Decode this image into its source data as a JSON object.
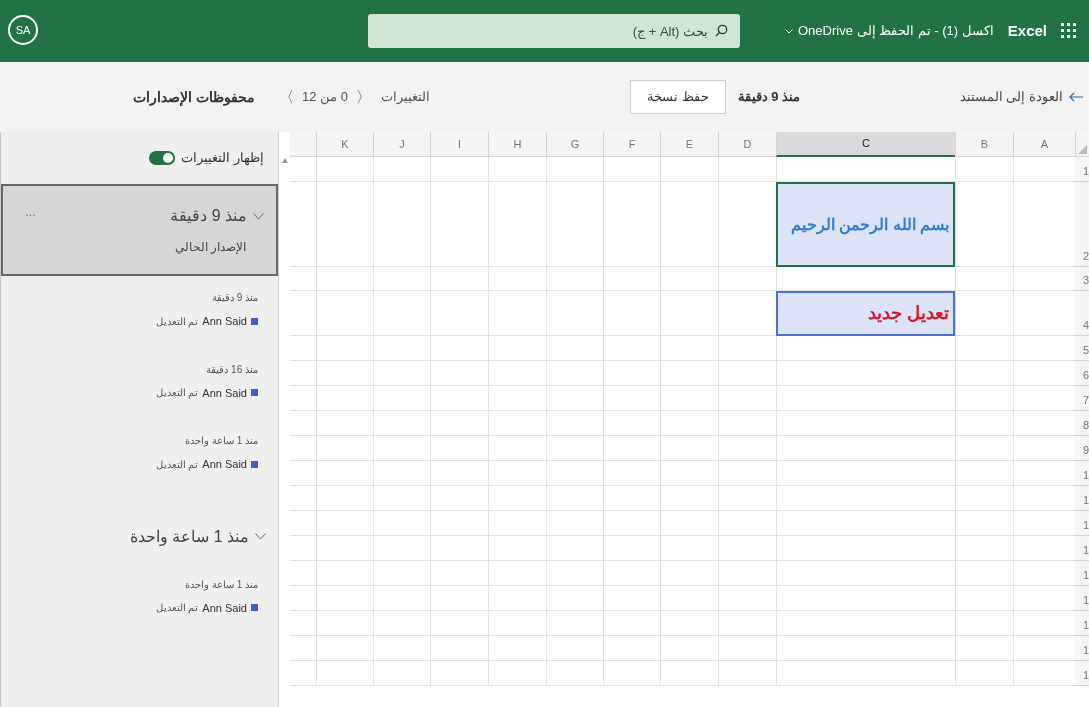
{
  "top_bar": {
    "app_name": "Excel",
    "file_title": "اكسل (1) - تم الحفظ إلى OneDrive",
    "search": {
      "placeholder": "بحث (Alt + ج)"
    },
    "avatar": "SA"
  },
  "toolbar": {
    "back_link": "العودة إلى المستند",
    "version_time": "منذ 9 دقيقة",
    "save_copy_button": "حفظ نسخة",
    "changes_label": "التغييرات",
    "changes_counter": "0 من 12",
    "previous_change": "〈",
    "next_change": "〉",
    "panel_title": "محفوظات الإصدارات"
  },
  "sidebar": {
    "show_changes": {
      "label": "إظهار التغييرات",
      "on": true
    },
    "groups": [
      {
        "title": "منذ 9 دقيقة",
        "subtitle": "الإصدار الحالي",
        "more_button": "…",
        "expanded": true,
        "selected": true,
        "entries": [
          {
            "time": "منذ 9 دقيقة",
            "author": "Ann Said",
            "action": "تم التعديل",
            "color": "#3b5bdb"
          },
          {
            "time": "منذ 16 دقيقة",
            "author": "Ann Said",
            "action": "تم التعديل",
            "color": "#3b5bdb"
          },
          {
            "time": "منذ 1 ساعة واحدة",
            "author": "Ann Said",
            "action": "تم التعديل",
            "color": "#3b5bdb"
          }
        ]
      },
      {
        "title": "منذ 1 ساعة واحدة",
        "expanded": true,
        "selected": false,
        "entries": [
          {
            "time": "منذ 1 ساعة واحدة",
            "author": "Ann Said",
            "action": "تم التعديل",
            "color": "#3b5bdb"
          }
        ]
      }
    ]
  },
  "sheet": {
    "columns": [
      {
        "label": "A",
        "selected": false
      },
      {
        "label": "B",
        "selected": false
      },
      {
        "label": "C",
        "selected": true
      },
      {
        "label": "D",
        "selected": false
      },
      {
        "label": "E",
        "selected": false
      },
      {
        "label": "F",
        "selected": false
      },
      {
        "label": "G",
        "selected": false
      },
      {
        "label": "H",
        "selected": false
      },
      {
        "label": "I",
        "selected": false
      },
      {
        "label": "J",
        "selected": false
      },
      {
        "label": "K",
        "selected": false
      }
    ],
    "rows": [
      {
        "label": "1"
      },
      {
        "label": "2",
        "cells": [
          null,
          null,
          {
            "text": "بسم الله الرحمن الرحيم",
            "color": "#2f7fd0",
            "selected": true
          }
        ]
      },
      {
        "label": "3"
      },
      {
        "label": "4",
        "cells": [
          null,
          null,
          {
            "text": "تعديل جديد",
            "color": "#e0112b",
            "selected": false
          }
        ]
      },
      {
        "label": "5"
      },
      {
        "label": "6"
      },
      {
        "label": "7"
      },
      {
        "label": "8"
      },
      {
        "label": "9"
      },
      {
        "label": "1"
      },
      {
        "label": "1"
      },
      {
        "label": "1"
      },
      {
        "label": "1"
      },
      {
        "label": "1"
      },
      {
        "label": "1"
      },
      {
        "label": "1"
      },
      {
        "label": "1"
      },
      {
        "label": "1"
      }
    ]
  }
}
